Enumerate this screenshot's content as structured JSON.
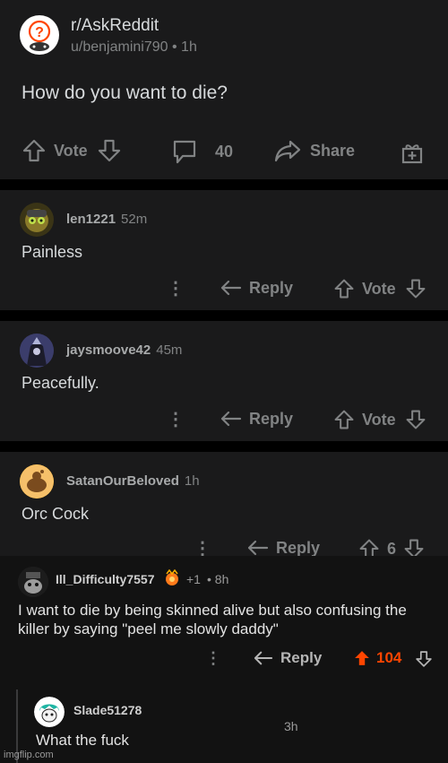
{
  "post": {
    "subreddit": "r/AskReddit",
    "author": "u/benjamini790",
    "age": "1h",
    "separator": "•",
    "title": "How do you want to die?",
    "vote_label": "Vote",
    "comment_count": "40",
    "share_label": "Share"
  },
  "comments": [
    {
      "user": "len1221",
      "time": "52m",
      "body": "Painless",
      "reply_label": "Reply",
      "vote_label": "Vote"
    },
    {
      "user": "jaysmoove42",
      "time": "45m",
      "body": "Peacefully.",
      "reply_label": "Reply",
      "vote_label": "Vote"
    },
    {
      "user": "SatanOurBeloved",
      "time": "1h",
      "body": "Orc Cock",
      "reply_label": "Reply",
      "vote_count": "6"
    }
  ],
  "second": {
    "user": "Ill_Difficulty7557",
    "karma": "+1",
    "time": "• 8h",
    "body": "I want to die by being skinned alive but also confusing the killer by saying \"peel me slowly daddy\"",
    "reply_label": "Reply",
    "score": "104",
    "reply": {
      "user": "Slade51278",
      "time": "3h",
      "body": "What the fuck"
    }
  },
  "watermark": "imgflip.com",
  "colors": {
    "background": "#000000",
    "card": "#1a1a1b",
    "text": "#d7dadc",
    "muted": "#818384",
    "upvote_accent": "#ff4500"
  },
  "icons": {
    "vote_up": "arrow-up-outline",
    "vote_down": "arrow-down-outline",
    "comments": "speech-bubble",
    "share": "share-arrow",
    "award": "gift-box",
    "reply": "reply-arrow",
    "more": "vertical-dots"
  }
}
